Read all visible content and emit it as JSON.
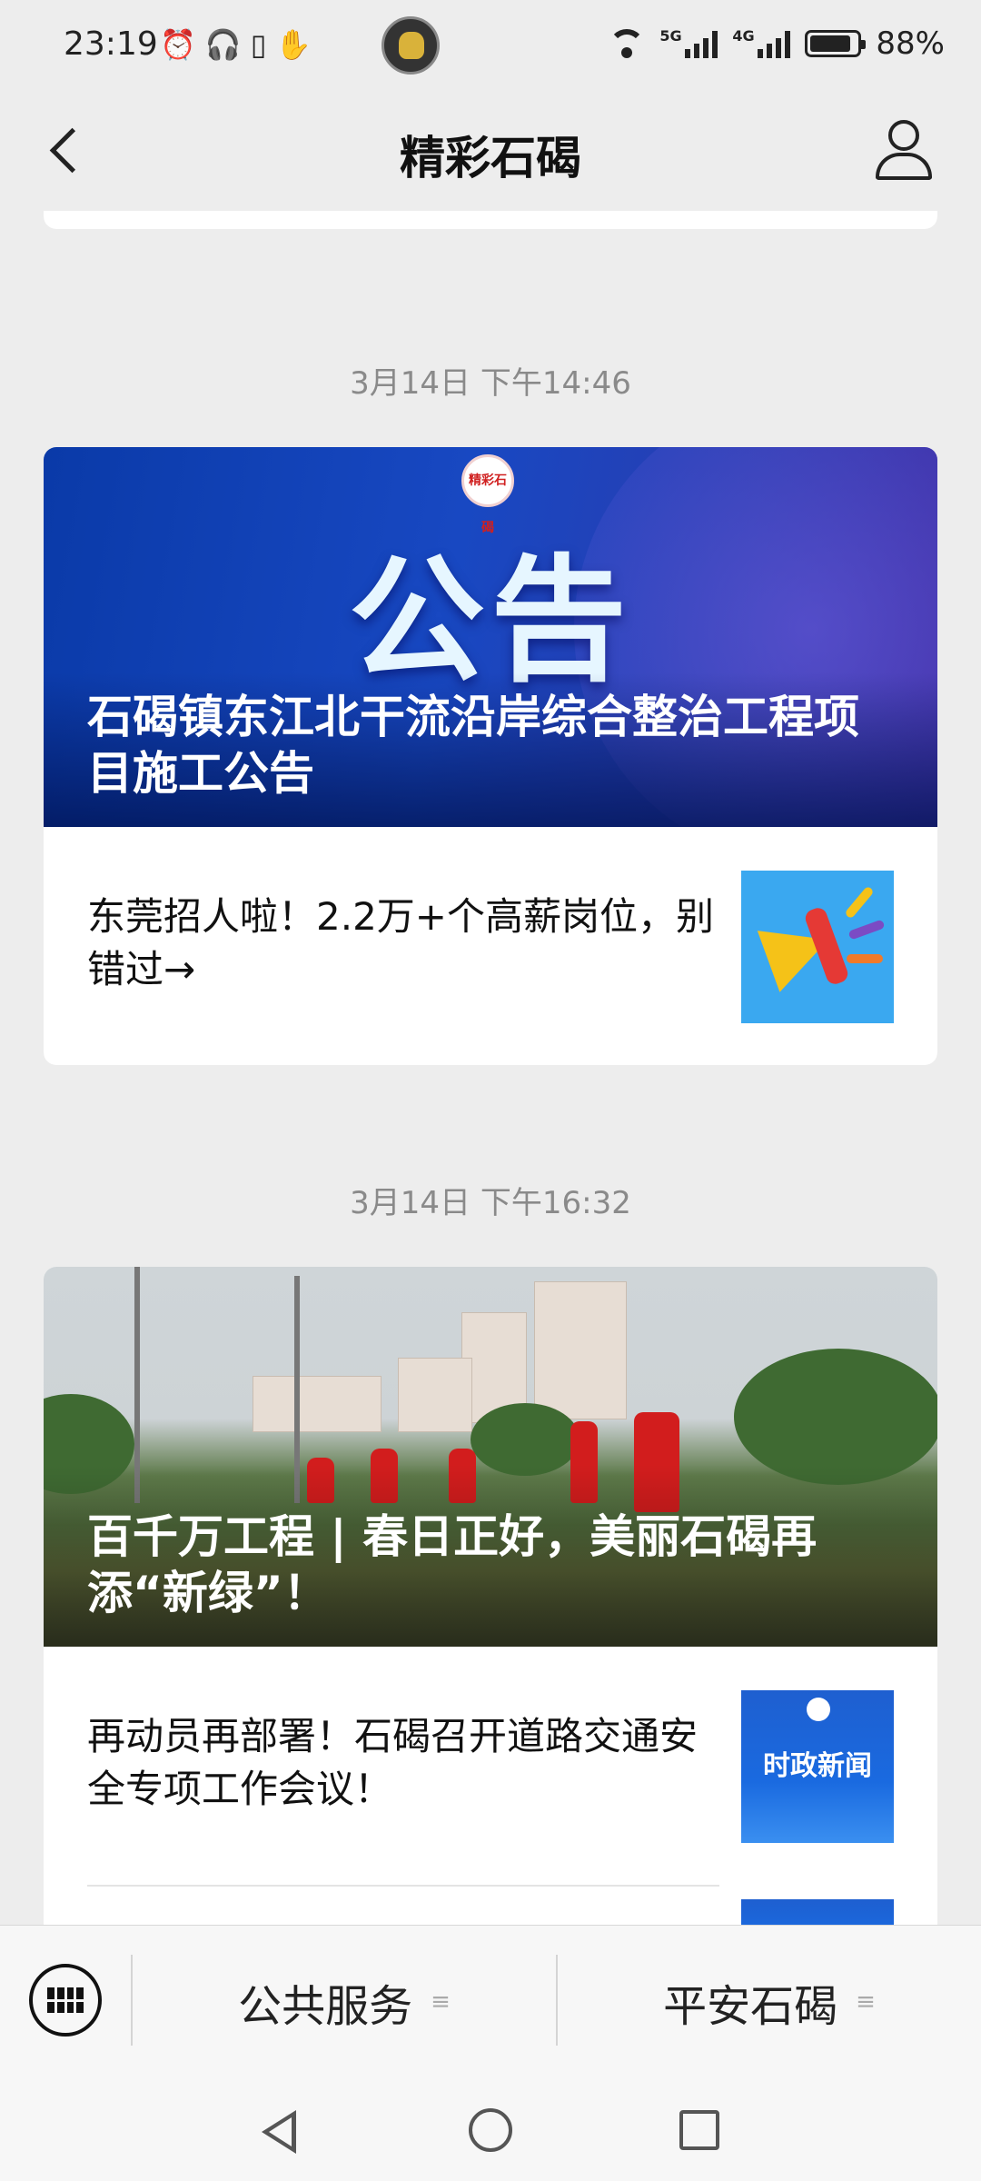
{
  "status_bar": {
    "time": "23:19",
    "left_icons": [
      "alarm-icon",
      "headphones-icon",
      "vibrate-icon",
      "hand-icon"
    ],
    "net_5g": "5G",
    "net_4g": "4G",
    "battery": "88%"
  },
  "header": {
    "title": "精彩石碣",
    "back_icon": "back-arrow-icon",
    "user_icon": "user-icon"
  },
  "feed": [
    {
      "timestamp": "3月14日 下午14:46",
      "hero": {
        "logo_text": "精彩石碣",
        "image_word": "公告",
        "caption": "石碣镇东江北干流沿岸综合整治工程项目施工公告"
      },
      "articles": [
        {
          "title": "东莞招人啦！2.2万+个高薪岗位，别错过→",
          "thumb": "megaphone-icon"
        }
      ]
    },
    {
      "timestamp": "3月14日 下午16:32",
      "hero": {
        "caption": "百千万工程 | 春日正好，美丽石碣再添“新绿”！"
      },
      "articles": [
        {
          "title": "再动员再部署！石碣召开道路交通安全专项工作会议！",
          "thumb_text": "时政新闻"
        }
      ]
    }
  ],
  "bottom_menu": {
    "keyboard_icon": "keyboard-icon",
    "items": [
      {
        "label": "公共服务"
      },
      {
        "label": "平安石碣"
      }
    ]
  },
  "nav_bar": {
    "icons": [
      "nav-back-icon",
      "nav-home-icon",
      "nav-recents-icon"
    ]
  },
  "colors": {
    "background": "#ededed",
    "card": "#ffffff",
    "accent_blue": "#1848c2",
    "timestamp": "#8a8a8a"
  }
}
